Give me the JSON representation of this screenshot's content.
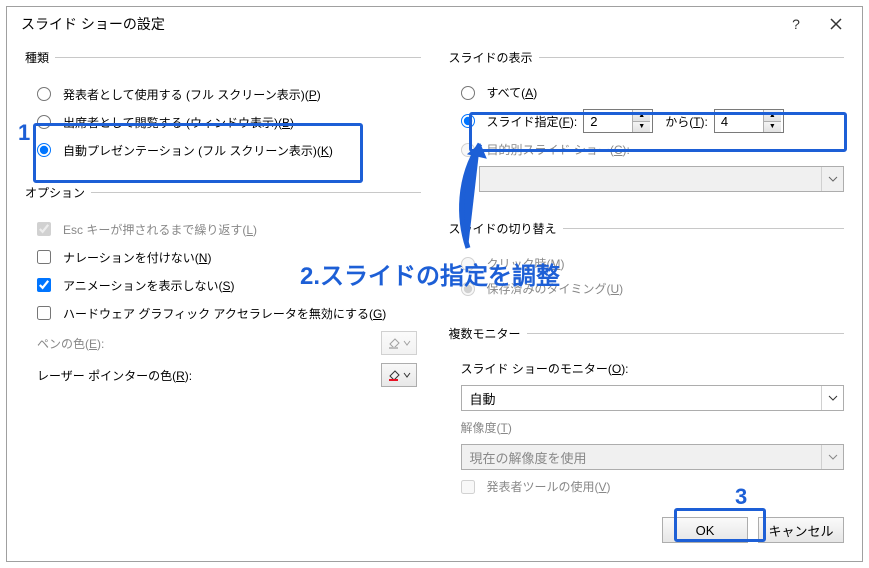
{
  "title": "スライド ショーの設定",
  "groups": {
    "kind": "種類",
    "options": "オプション",
    "show": "スライドの表示",
    "switch": "スライドの切り替え",
    "monitors": "複数モニター"
  },
  "kind": {
    "presenter": "発表者として使用する (フル スクリーン表示)(",
    "presenter_k": "P",
    "attendee": "出席者として閲覧する (ウィンドウ表示)(",
    "attendee_k": "B",
    "auto": "自動プレゼンテーション (フル スクリーン表示)(",
    "auto_k": "K"
  },
  "options": {
    "esc": "Esc キーが押されるまで繰り返す(",
    "esc_k": "L",
    "narr": "ナレーションを付けない(",
    "narr_k": "N",
    "anim": "アニメーションを表示しない(",
    "anim_k": "S",
    "hw": "ハードウェア グラフィック アクセラレータを無効にする(",
    "hw_k": "G",
    "pen": "ペンの色(",
    "pen_k": "E",
    "laser": "レーザー ポインターの色(",
    "laser_k": "R"
  },
  "show": {
    "all": "すべて(",
    "all_k": "A",
    "range": "スライド指定(",
    "range_k": "F",
    "from_val": "2",
    "to_lbl": "から(",
    "to_k": "T",
    "to_val": "4",
    "custom": "目的別スライド ショー(",
    "custom_k": "C"
  },
  "switch": {
    "click": "クリック時(",
    "click_k": "M",
    "timing": "保存済みのタイミング(",
    "timing_k": "U"
  },
  "monitors": {
    "mon_lbl": "スライド ショーのモニター(",
    "mon_k": "O",
    "mon_val": "自動",
    "res_lbl": "解像度(",
    "res_k": "T",
    "res_val": "現在の解像度を使用",
    "pv": "発表者ツールの使用(",
    "pv_k": "V"
  },
  "buttons": {
    "ok": "OK",
    "cancel": "キャンセル"
  },
  "annotations": {
    "n1": "1",
    "n2": "2.スライドの指定を調整",
    "n3": "3"
  },
  "close_paren": ")",
  "colon": "):",
  "close_paren_colon": "):"
}
